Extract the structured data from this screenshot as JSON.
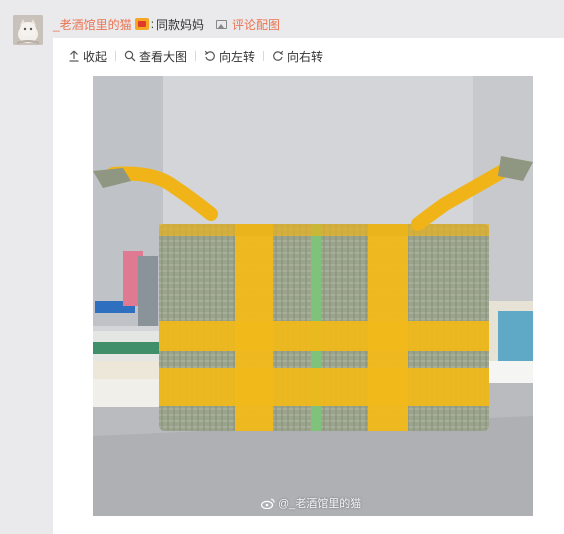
{
  "comment": {
    "username": "_老酒馆里的猫",
    "colon": ":",
    "text": "同款妈妈",
    "pic_link_label": "评论配图"
  },
  "toolbar": {
    "collapse_label": "收起",
    "view_large_label": "查看大图",
    "rotate_left_label": "向左转",
    "rotate_right_label": "向右转"
  },
  "photo": {
    "watermark": "@_老酒馆里的猫"
  },
  "colors": {
    "username": "#eb7350",
    "link": "#eb7350",
    "background": "#eaeaec",
    "panel": "#ffffff"
  }
}
